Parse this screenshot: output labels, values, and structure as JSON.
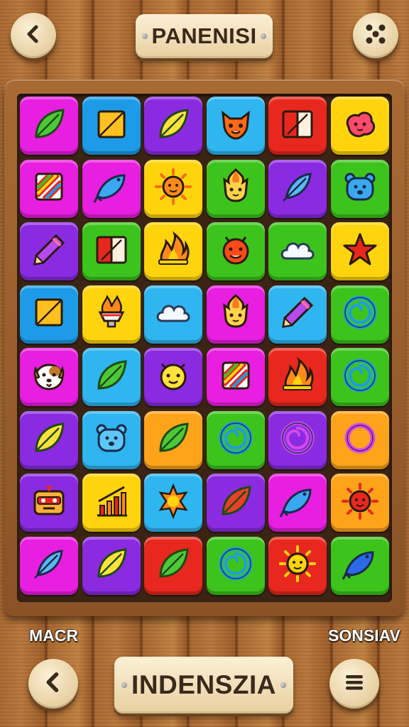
{
  "header": {
    "title": "PANENISI",
    "back_icon": "chevron-left-icon",
    "options_icon": "dice-icon"
  },
  "footer": {
    "left_label": "MACR",
    "right_label": "SONSIAV",
    "button_label": "INDENSZIA",
    "back_icon": "chevron-left-icon",
    "menu_icon": "hamburger-menu-icon"
  },
  "colors": {
    "magenta": "#e81ee0",
    "blue": "#1e9be8",
    "purple": "#8a2be2",
    "cyan": "#2fb5f0",
    "red": "#e8281e",
    "yellow": "#ffd40d",
    "green": "#3cc41c",
    "orange": "#ffa31a"
  },
  "board": {
    "rows": [
      [
        {
          "color": "magenta",
          "icon": "leaf"
        },
        {
          "color": "blue",
          "icon": "square"
        },
        {
          "color": "purple",
          "icon": "leaf"
        },
        {
          "color": "cyan",
          "icon": "fox"
        },
        {
          "color": "red",
          "icon": "book"
        },
        {
          "color": "yellow",
          "icon": "blob"
        }
      ],
      [
        {
          "color": "magenta",
          "icon": "rainbow"
        },
        {
          "color": "magenta",
          "icon": "fish"
        },
        {
          "color": "yellow",
          "icon": "sun"
        },
        {
          "color": "green",
          "icon": "cat-fire"
        },
        {
          "color": "purple",
          "icon": "feather"
        },
        {
          "color": "green",
          "icon": "bear"
        }
      ],
      [
        {
          "color": "purple",
          "icon": "pencil"
        },
        {
          "color": "green",
          "icon": "book"
        },
        {
          "color": "yellow",
          "icon": "fire"
        },
        {
          "color": "green",
          "icon": "devil"
        },
        {
          "color": "green",
          "icon": "cloud"
        },
        {
          "color": "yellow",
          "icon": "star"
        }
      ],
      [
        {
          "color": "blue",
          "icon": "square"
        },
        {
          "color": "yellow",
          "icon": "torch"
        },
        {
          "color": "cyan",
          "icon": "cloud"
        },
        {
          "color": "magenta",
          "icon": "cat-fire"
        },
        {
          "color": "cyan",
          "icon": "pencil"
        },
        {
          "color": "green",
          "icon": "spiral"
        }
      ],
      [
        {
          "color": "magenta",
          "icon": "dog"
        },
        {
          "color": "cyan",
          "icon": "leaf"
        },
        {
          "color": "purple",
          "icon": "yellow-face"
        },
        {
          "color": "magenta",
          "icon": "rainbow"
        },
        {
          "color": "red",
          "icon": "fire"
        },
        {
          "color": "green",
          "icon": "spiral"
        }
      ],
      [
        {
          "color": "purple",
          "icon": "leaf"
        },
        {
          "color": "cyan",
          "icon": "bear"
        },
        {
          "color": "orange",
          "icon": "leaf"
        },
        {
          "color": "green",
          "icon": "spiral"
        },
        {
          "color": "purple",
          "icon": "spiral"
        },
        {
          "color": "orange",
          "icon": "ring"
        }
      ],
      [
        {
          "color": "purple",
          "icon": "robot"
        },
        {
          "color": "yellow",
          "icon": "chart"
        },
        {
          "color": "cyan",
          "icon": "flame-sun"
        },
        {
          "color": "purple",
          "icon": "leaf"
        },
        {
          "color": "magenta",
          "icon": "fish"
        },
        {
          "color": "orange",
          "icon": "sun"
        }
      ],
      [
        {
          "color": "magenta",
          "icon": "feather"
        },
        {
          "color": "purple",
          "icon": "leaf"
        },
        {
          "color": "red",
          "icon": "leaf"
        },
        {
          "color": "green",
          "icon": "spiral"
        },
        {
          "color": "red",
          "icon": "sun"
        },
        {
          "color": "green",
          "icon": "fish"
        }
      ]
    ]
  }
}
